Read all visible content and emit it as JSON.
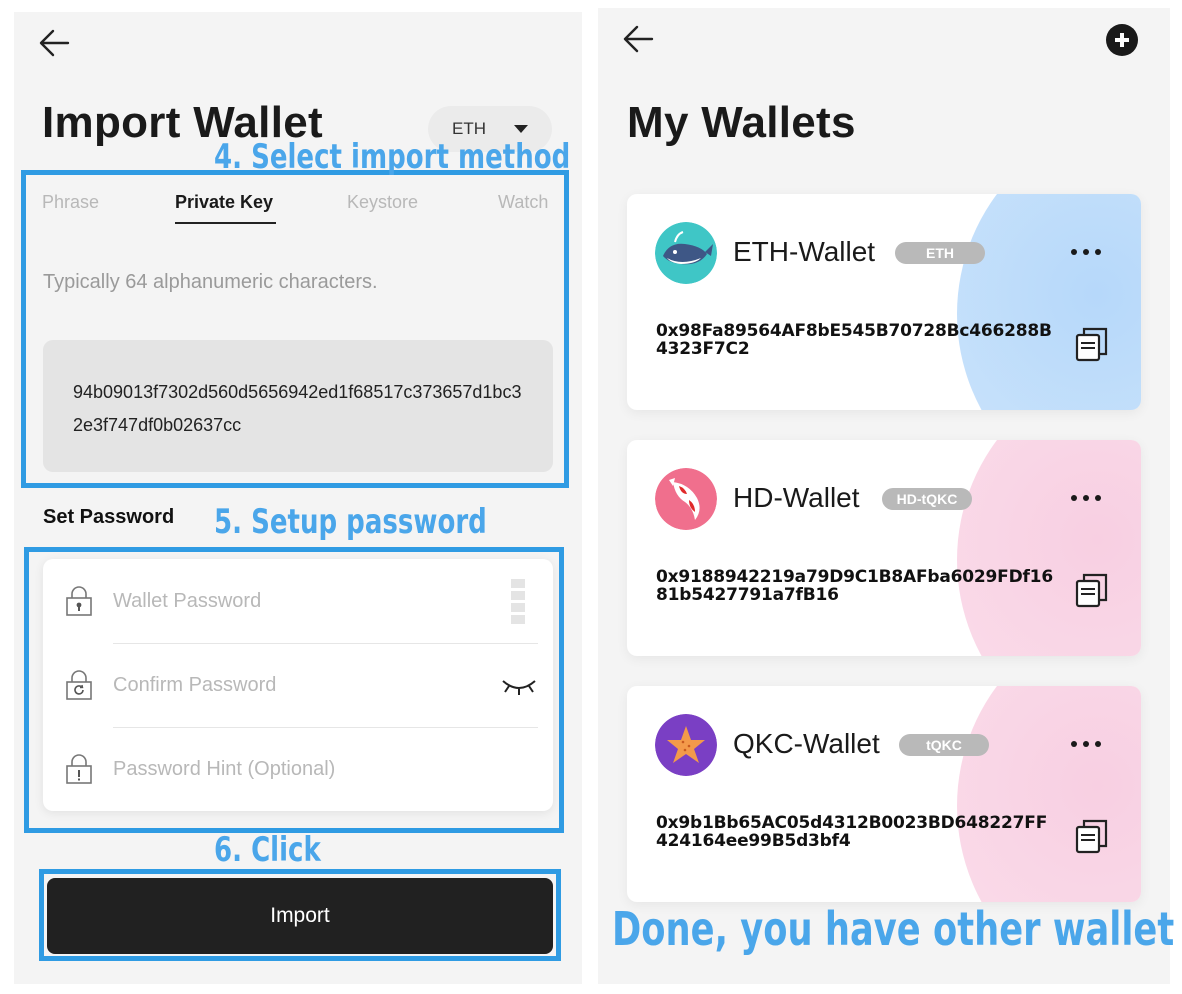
{
  "import_screen": {
    "title": "Import Wallet",
    "chain_select": {
      "value": "ETH"
    },
    "tabs": [
      {
        "label": "Phrase",
        "active": false
      },
      {
        "label": "Private Key",
        "active": true
      },
      {
        "label": "Keystore",
        "active": false
      },
      {
        "label": "Watch",
        "active": false
      }
    ],
    "hint": "Typically 64 alphanumeric characters.",
    "private_key_value": "94b09013f7302d560d5656942ed1f68517c373657d1bc32e3f747df0b02637cc",
    "password_section_label": "Set Password",
    "fields": {
      "wallet_password_placeholder": "Wallet Password",
      "confirm_password_placeholder": "Confirm Password",
      "password_hint_placeholder": "Password Hint (Optional)"
    },
    "import_button_label": "Import"
  },
  "annotations": {
    "step4": "4. Select import method",
    "step5": "5. Setup password",
    "step6": "6. Click",
    "done": "Done,   you have other wallet",
    "color": "#2f9be3"
  },
  "wallets_screen": {
    "title": "My Wallets",
    "wallets": [
      {
        "name": "ETH-Wallet",
        "badge": "ETH",
        "address": "0x98Fa89564AF8bE545B70728Bc466288B4323F7C2",
        "avatar_icon": "whale-icon",
        "glow_color": "#bcdcf8"
      },
      {
        "name": "HD-Wallet",
        "badge": "HD-tQKC",
        "address": "0x9188942219a79D9C1B8AFba6029FDf1681b5427791a7fB16",
        "avatar_icon": "koi-fish-icon",
        "glow_color": "#f8d4e6"
      },
      {
        "name": "QKC-Wallet",
        "badge": "tQKC",
        "address": "0x9b1Bb65AC05d4312B0023BD648227FF424164ee99B5d3bf4",
        "avatar_icon": "starfish-icon",
        "glow_color": "#f8d4e6"
      }
    ]
  }
}
